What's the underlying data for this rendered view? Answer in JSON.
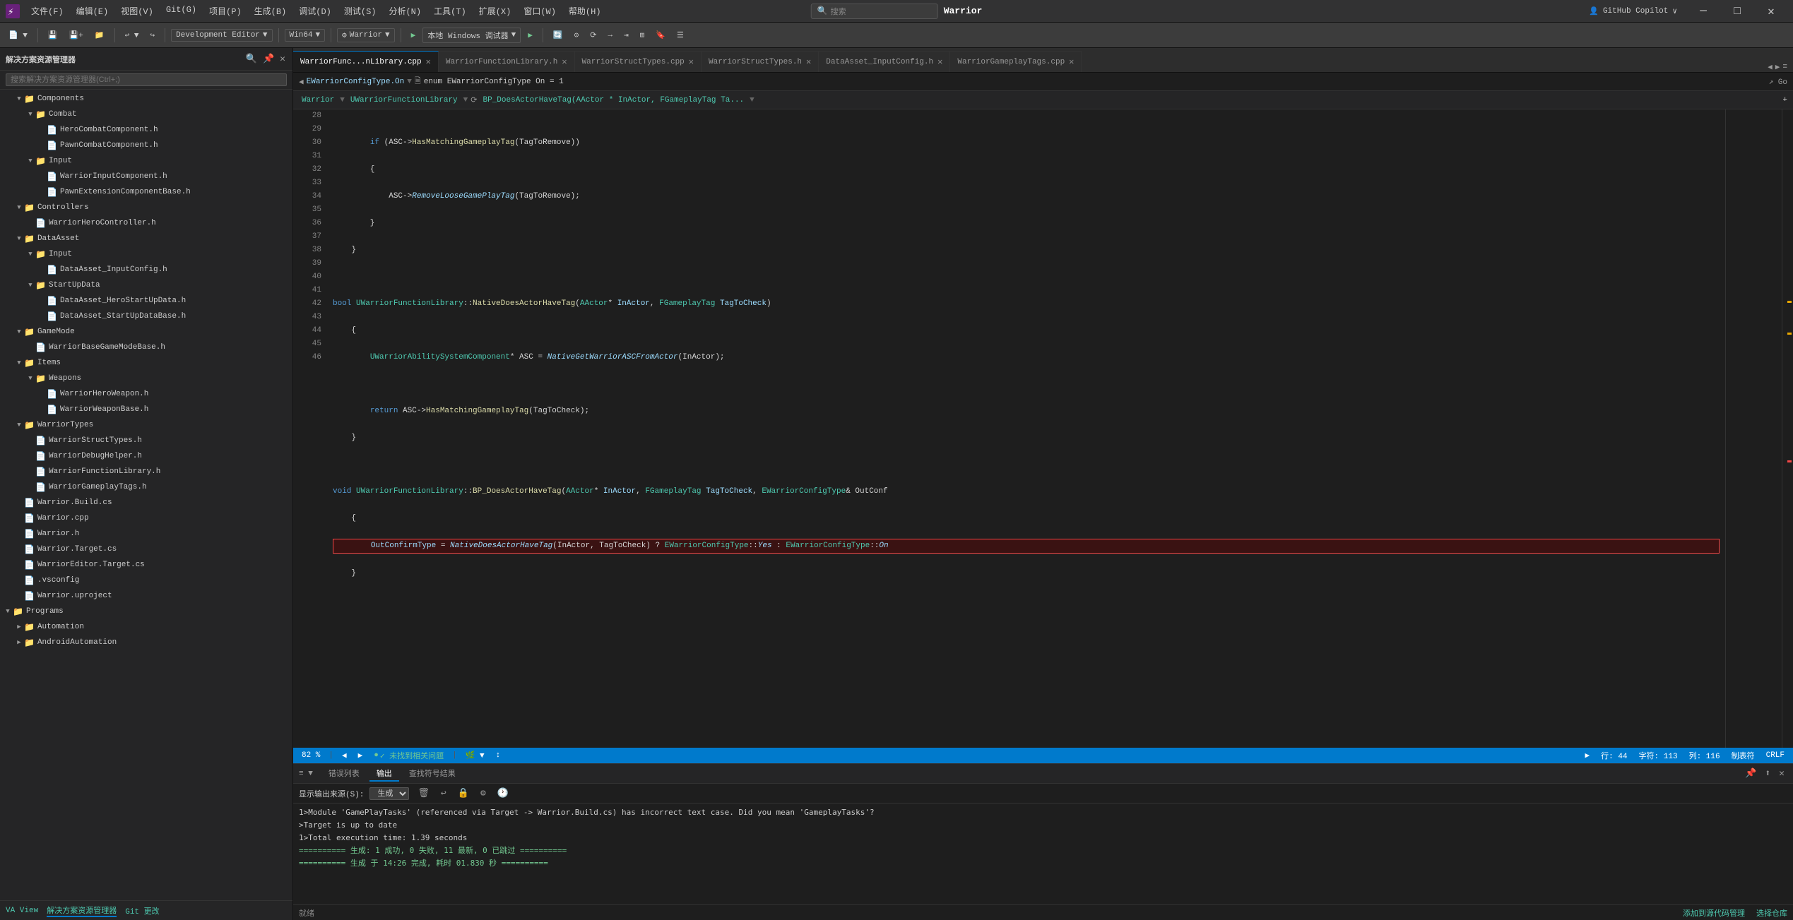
{
  "app": {
    "title": "Warrior",
    "logo": "⚡"
  },
  "titlebar": {
    "menus": [
      "文件(F)",
      "编辑(E)",
      "视图(V)",
      "Git(G)",
      "项目(P)",
      "生成(B)",
      "调试(D)",
      "测试(S)",
      "分析(N)",
      "工具(T)",
      "扩展(X)",
      "窗口(W)",
      "帮助(H)"
    ],
    "search_placeholder": "搜索...",
    "search_label": "搜索",
    "project_name": "Warrior",
    "min_btn": "─",
    "max_btn": "□",
    "close_btn": "✕"
  },
  "toolbar": {
    "back_btn": "◀",
    "forward_btn": "▶",
    "undo_btn": "↩",
    "redo_btn": "↪",
    "run_config": "Development Editor",
    "platform": "Win64",
    "project": "Warrior",
    "run_btn": "▶",
    "debug_btn": "本地 Windows 调试器",
    "copilot": "GitHub Copilot"
  },
  "sidebar": {
    "title": "解决方案资源管理器",
    "search_placeholder": "搜索解决方案资源管理器(Ctrl+;)",
    "tree": [
      {
        "id": "components",
        "label": "Components",
        "type": "folder",
        "indent": 1,
        "expanded": true
      },
      {
        "id": "combat",
        "label": "Combat",
        "type": "folder",
        "indent": 2,
        "expanded": true
      },
      {
        "id": "herocombat-h",
        "label": "HeroCombatComponent.h",
        "type": "file-h",
        "indent": 3
      },
      {
        "id": "pawncombat-h",
        "label": "PawnCombatComponent.h",
        "type": "file-h",
        "indent": 3
      },
      {
        "id": "input",
        "label": "Input",
        "type": "folder",
        "indent": 2,
        "expanded": true
      },
      {
        "id": "warriorinput-h",
        "label": "WarriorInputComponent.h",
        "type": "file-h",
        "indent": 3
      },
      {
        "id": "pawnext-h",
        "label": "PawnExtensionComponentBase.h",
        "type": "file-h",
        "indent": 3
      },
      {
        "id": "controllers",
        "label": "Controllers",
        "type": "folder",
        "indent": 1,
        "expanded": true
      },
      {
        "id": "warriorhero-h",
        "label": "WarriorHeroController.h",
        "type": "file-h",
        "indent": 2
      },
      {
        "id": "dataasset",
        "label": "DataAsset",
        "type": "folder",
        "indent": 1,
        "expanded": true
      },
      {
        "id": "input2",
        "label": "Input",
        "type": "folder",
        "indent": 2,
        "expanded": true
      },
      {
        "id": "dataasset-inputconfig-h",
        "label": "DataAsset_InputConfig.h",
        "type": "file-h",
        "indent": 3
      },
      {
        "id": "startup",
        "label": "StartUpData",
        "type": "folder",
        "indent": 2,
        "expanded": true
      },
      {
        "id": "herostartup-h",
        "label": "DataAsset_HeroStartUpData.h",
        "type": "file-h",
        "indent": 3
      },
      {
        "id": "basestartup-h",
        "label": "DataAsset_StartUpDataBase.h",
        "type": "file-h",
        "indent": 3
      },
      {
        "id": "gamemode",
        "label": "GameMode",
        "type": "folder",
        "indent": 1,
        "expanded": true
      },
      {
        "id": "warriorbase-h",
        "label": "WarriorBaseGameModeBase.h",
        "type": "file-h",
        "indent": 2
      },
      {
        "id": "items",
        "label": "Items",
        "type": "folder",
        "indent": 1,
        "expanded": true
      },
      {
        "id": "weapons",
        "label": "Weapons",
        "type": "folder",
        "indent": 2,
        "expanded": true
      },
      {
        "id": "heroweapon-h",
        "label": "WarriorHeroWeapon.h",
        "type": "file-h",
        "indent": 3
      },
      {
        "id": "weaponbase-h",
        "label": "WarriorWeaponBase.h",
        "type": "file-h",
        "indent": 3
      },
      {
        "id": "warriortypes",
        "label": "WarriorTypes",
        "type": "folder",
        "indent": 1,
        "expanded": true
      },
      {
        "id": "structtypes-h",
        "label": "WarriorStructTypes.h",
        "type": "file-h",
        "indent": 2
      },
      {
        "id": "debughelper-h",
        "label": "WarriorDebugHelper.h",
        "type": "file-h",
        "indent": 2
      },
      {
        "id": "functionlib-h",
        "label": "WarriorFunctionLibrary.h",
        "type": "file-h",
        "indent": 2
      },
      {
        "id": "gameplaytags-h",
        "label": "WarriorGameplayTags.h",
        "type": "file-h",
        "indent": 2
      },
      {
        "id": "warrior-build-cs",
        "label": "Warrior.Build.cs",
        "type": "file-cs",
        "indent": 1
      },
      {
        "id": "warrior-cpp",
        "label": "Warrior.cpp",
        "type": "file-cpp",
        "indent": 1
      },
      {
        "id": "warrior-h",
        "label": "Warrior.h",
        "type": "file-h",
        "indent": 1
      },
      {
        "id": "warrior-target",
        "label": "Warrior.Target.cs",
        "type": "file-config",
        "indent": 1
      },
      {
        "id": "warrioreditor-target",
        "label": "WarriorEditor.Target.cs",
        "type": "file-config",
        "indent": 1
      },
      {
        "id": "vsconfig",
        "label": ".vsconfig",
        "type": "file-config",
        "indent": 1
      },
      {
        "id": "warrior-uproject",
        "label": "Warrior.uproject",
        "type": "file-config",
        "indent": 1
      },
      {
        "id": "programs",
        "label": "Programs",
        "type": "folder",
        "indent": 0,
        "expanded": true
      },
      {
        "id": "automation",
        "label": "Automation",
        "type": "folder",
        "indent": 1,
        "expanded": false
      },
      {
        "id": "android-automation",
        "label": "AndroidAutomation",
        "type": "folder",
        "indent": 1,
        "expanded": false
      }
    ]
  },
  "tabs": [
    {
      "id": "warrior-func-cpp",
      "label": "WarriorFunc...nLibrary.cpp",
      "active": true,
      "modified": false
    },
    {
      "id": "warrior-func-h",
      "label": "WarriorFunctionLibrary.h",
      "active": false,
      "modified": false
    },
    {
      "id": "warrior-struct-cpp",
      "label": "WarriorStructTypes.cpp",
      "active": false,
      "modified": false
    },
    {
      "id": "warrior-struct-h",
      "label": "WarriorStructTypes.h",
      "active": false,
      "modified": false
    },
    {
      "id": "dataasset-inputconfig-h2",
      "label": "DataAsset_InputConfig.h",
      "active": false,
      "modified": false
    },
    {
      "id": "warrior-gameplay-tags-cpp",
      "label": "WarriorGameplayTags.cpp",
      "active": false,
      "modified": false
    }
  ],
  "breadcrumb": {
    "items": [
      "EWarriorConfigType.On",
      "enum EWarriorConfigType On = 1"
    ]
  },
  "code_nav": {
    "scope": "Warrior",
    "function": "UWarriorFunctionLibrary",
    "full_sig": "BP_DoesActorHaveTag(AActor * InActor, FGameplayTag Ta..."
  },
  "code": {
    "lines": [
      {
        "num": 28,
        "text": ""
      },
      {
        "num": 29,
        "text": "            if (ASC->HasMatchingGameplayTag(TagToRemove))"
      },
      {
        "num": 30,
        "text": "            {"
      },
      {
        "num": 31,
        "text": "                ASC->RemoveLooseGamePlayTag(TagToRemove);"
      },
      {
        "num": 32,
        "text": "            }"
      },
      {
        "num": 33,
        "text": "        }"
      },
      {
        "num": 34,
        "text": ""
      },
      {
        "num": 35,
        "text": "bool UWarriorFunctionLibrary::NativeDoesActorHaveTag(AActor* InActor, FGameplayTag TagToCheck)"
      },
      {
        "num": 36,
        "text": "        {"
      },
      {
        "num": 37,
        "text": "            UWarriorAbilitySystemComponent* ASC = NativeGetWarriorASCFromActor(InActor);"
      },
      {
        "num": 38,
        "text": ""
      },
      {
        "num": 39,
        "text": "            return ASC->HasMatchingGameplayTag(TagToCheck);"
      },
      {
        "num": 40,
        "text": "        }"
      },
      {
        "num": 41,
        "text": ""
      },
      {
        "num": 42,
        "text": "void UWarriorFunctionLibrary::BP_DoesActorHaveTag(AActor* InActor, FGameplayTag TagToCheck, EWarriorConfigType& OutConf"
      },
      {
        "num": 43,
        "text": "        {"
      },
      {
        "num": 44,
        "text": "            OutConfirmType = NativeDoesActorHaveTag(InActor, TagToCheck) ? EWarriorConfigType::Yes : EWarriorConfigType::On"
      },
      {
        "num": 45,
        "text": "        }"
      },
      {
        "num": 46,
        "text": ""
      }
    ]
  },
  "status_bar": {
    "zoom": "82 %",
    "no_problems": "✓ 未找到相关问题",
    "line": "行: 44",
    "char": "字符: 113",
    "col": "列: 116",
    "encoding": "制表符",
    "line_ending": "CRLF",
    "bottom_left": "就绪",
    "add_to_source": "添加到源代码管理",
    "select_repo": "选择仓库"
  },
  "bottom_panel": {
    "tabs": [
      "错误列表",
      "输出",
      "查找符号结果"
    ],
    "active_tab": "输出",
    "output_source_label": "显示输出来源(S):",
    "output_source_value": "生成",
    "output_lines": [
      "1>Module 'GamePlayTasks' (referenced via Target -> Warrior.Build.cs) has incorrect text case. Did you mean 'GameplayTasks'?",
      ">Target is up to date",
      "1>Total execution time: 1.39 seconds",
      "========== 生成: 1 成功, 0 失败, 11 最新, 0 已跳过 ==========",
      "========== 生成 于 14:26 完成, 耗时 01.830 秒 =========="
    ]
  },
  "va_bar": {
    "va_view": "VA View",
    "solution_explorer": "解决方案资源管理器",
    "git_changes": "Git 更改"
  }
}
